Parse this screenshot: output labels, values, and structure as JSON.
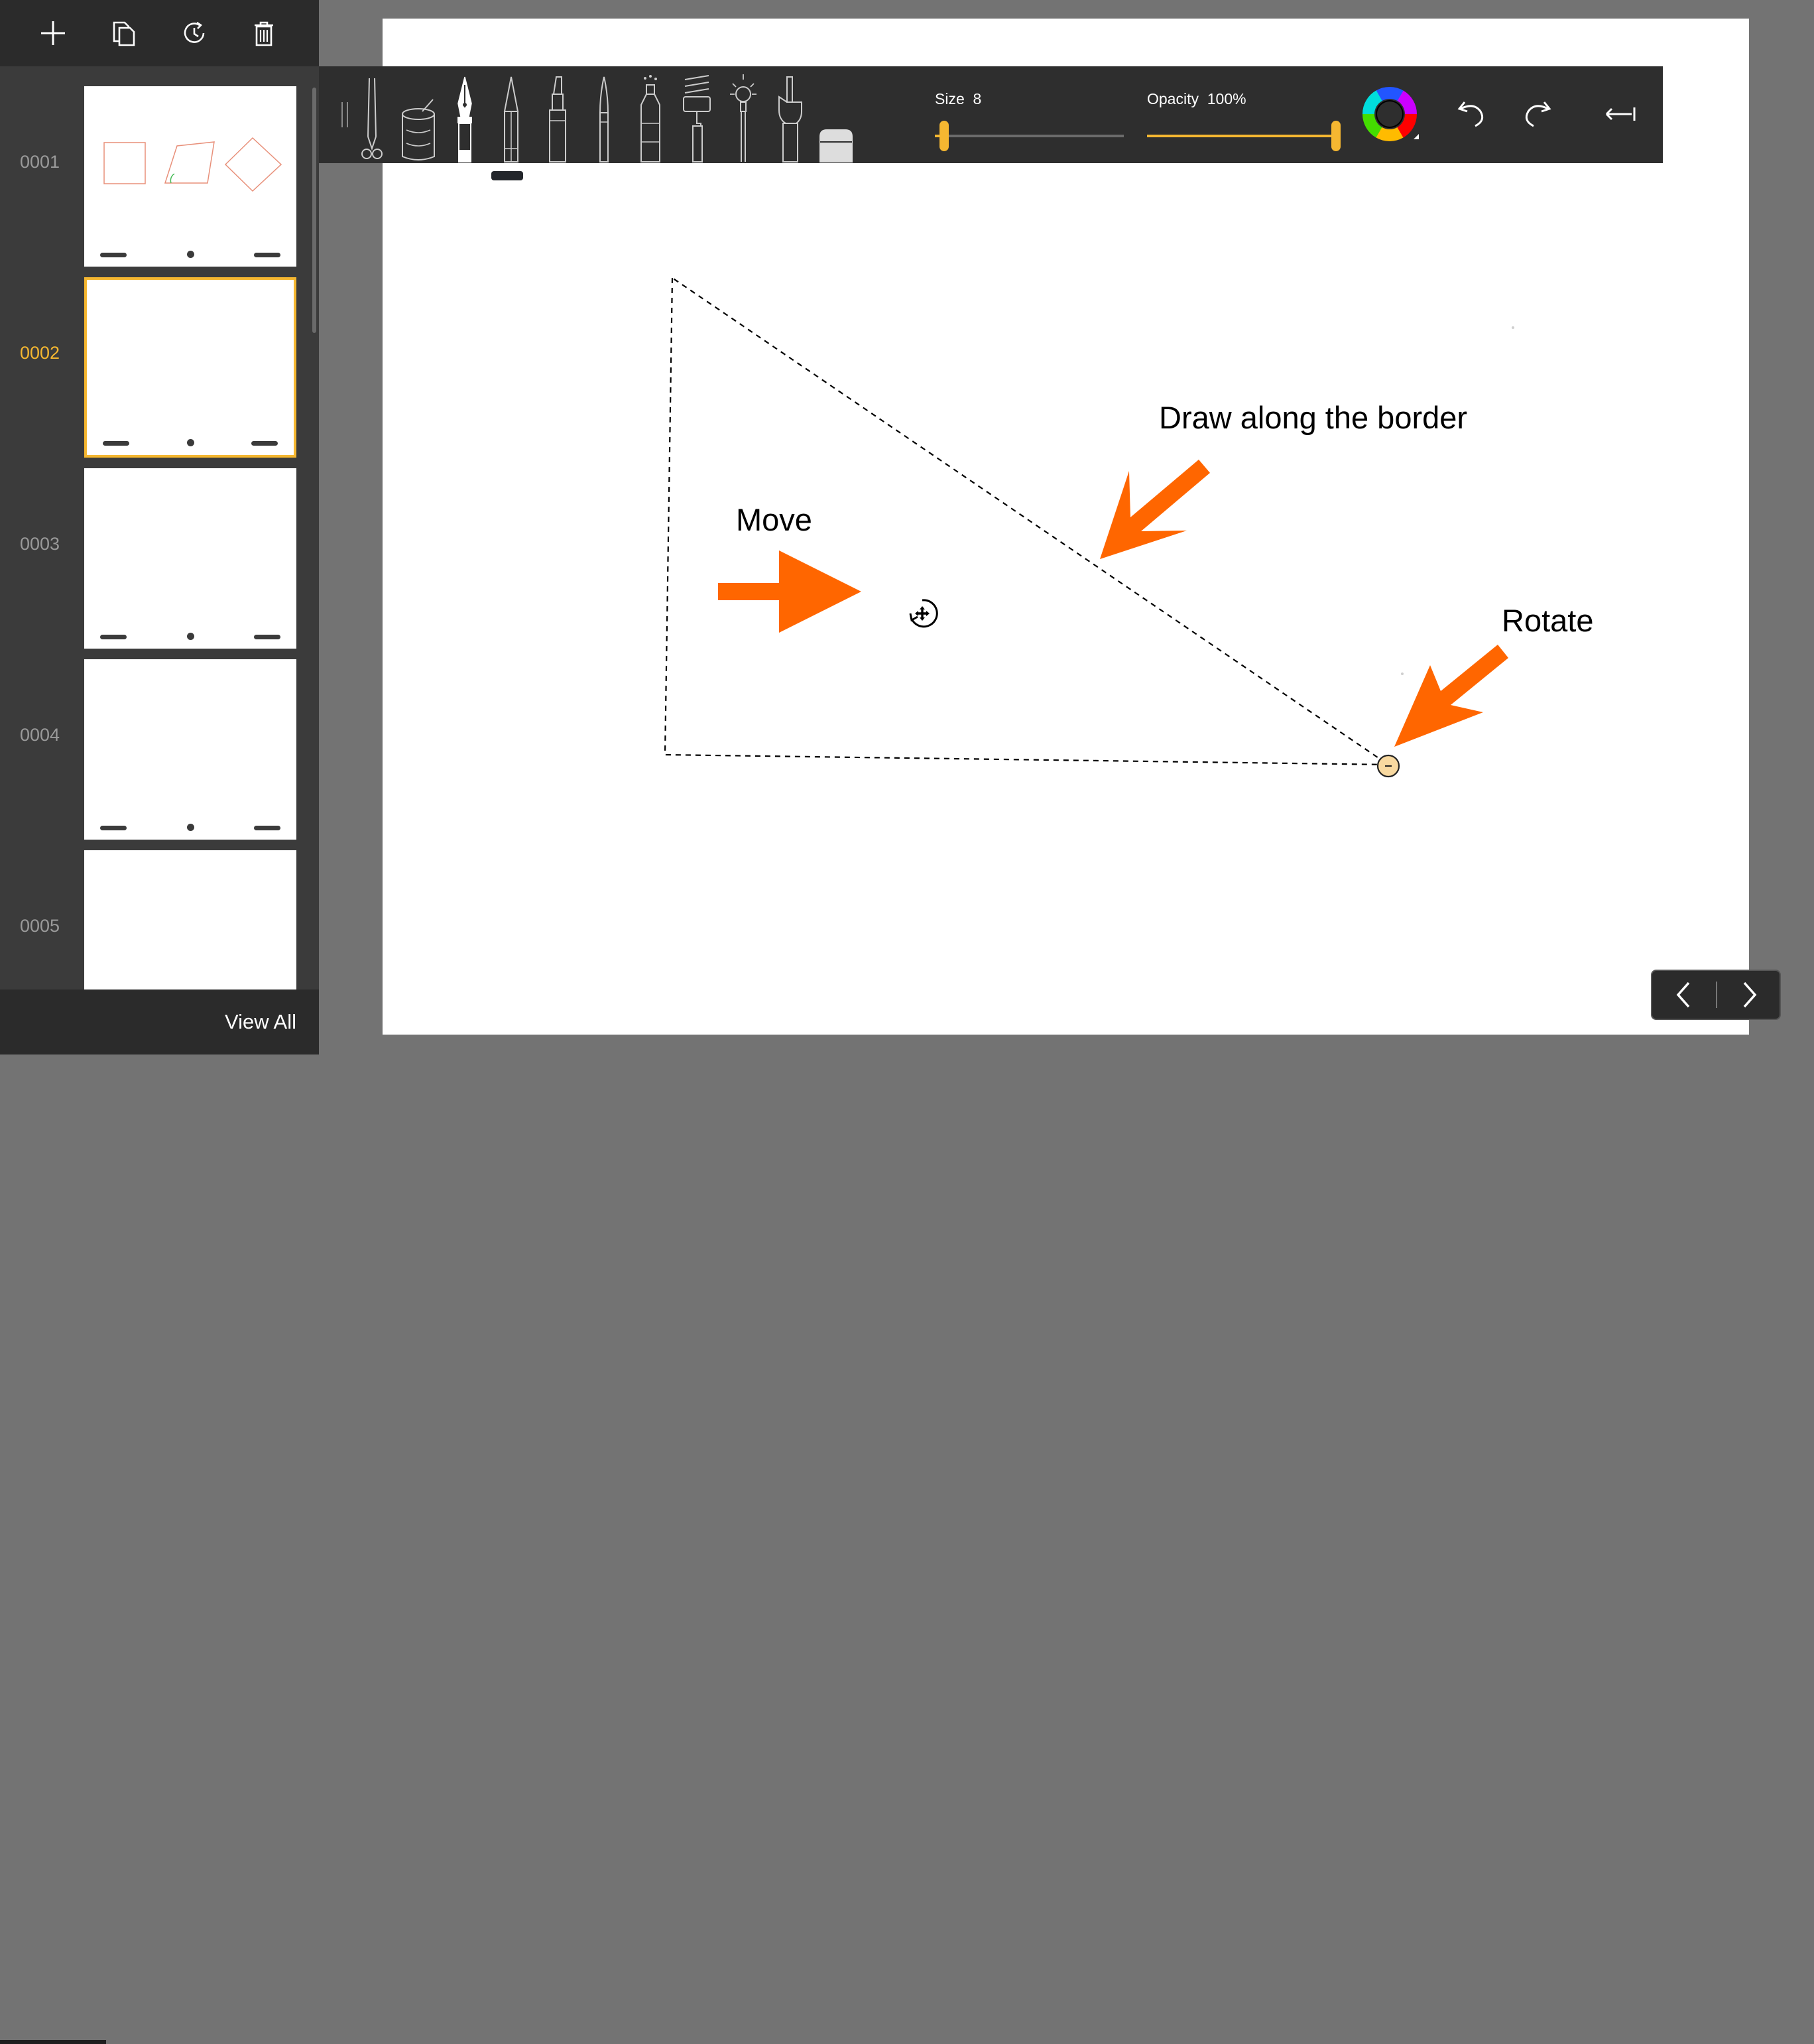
{
  "sidebar": {
    "toolbar_icons": [
      "add-icon",
      "copy-icon",
      "history-icon",
      "trash-icon"
    ],
    "pages": [
      {
        "number": "0001",
        "active": false
      },
      {
        "number": "0002",
        "active": true
      },
      {
        "number": "0003",
        "active": false
      },
      {
        "number": "0004",
        "active": false
      },
      {
        "number": "0005",
        "active": false
      }
    ],
    "view_all_label": "View All"
  },
  "toolbar": {
    "tools": [
      "scissors-icon",
      "paint-bucket-icon",
      "fountain-pen-icon",
      "pencil-icon",
      "marker-icon",
      "brush-icon",
      "crayon-icon",
      "spray-can-icon",
      "paint-roller-icon",
      "glitter-wand-icon",
      "finger-smudge-icon",
      "eraser-icon"
    ],
    "selected_tool": "fountain-pen-icon",
    "size_label": "Size",
    "size_value": "8",
    "opacity_label": "Opacity",
    "opacity_value": "100%",
    "size_fraction": 0.05,
    "opacity_fraction": 1.0
  },
  "canvas": {
    "annotations": {
      "draw_border": "Draw along the border",
      "move": "Move",
      "rotate": "Rotate"
    },
    "accent_color": "#ff6600",
    "handle_color": "#f8d9a0"
  },
  "colors": {
    "accent": "#f5b731",
    "sidebar_bg": "#3b3b3b",
    "toolbar_bg": "#2e2e2e",
    "arrow": "#ff6600"
  }
}
